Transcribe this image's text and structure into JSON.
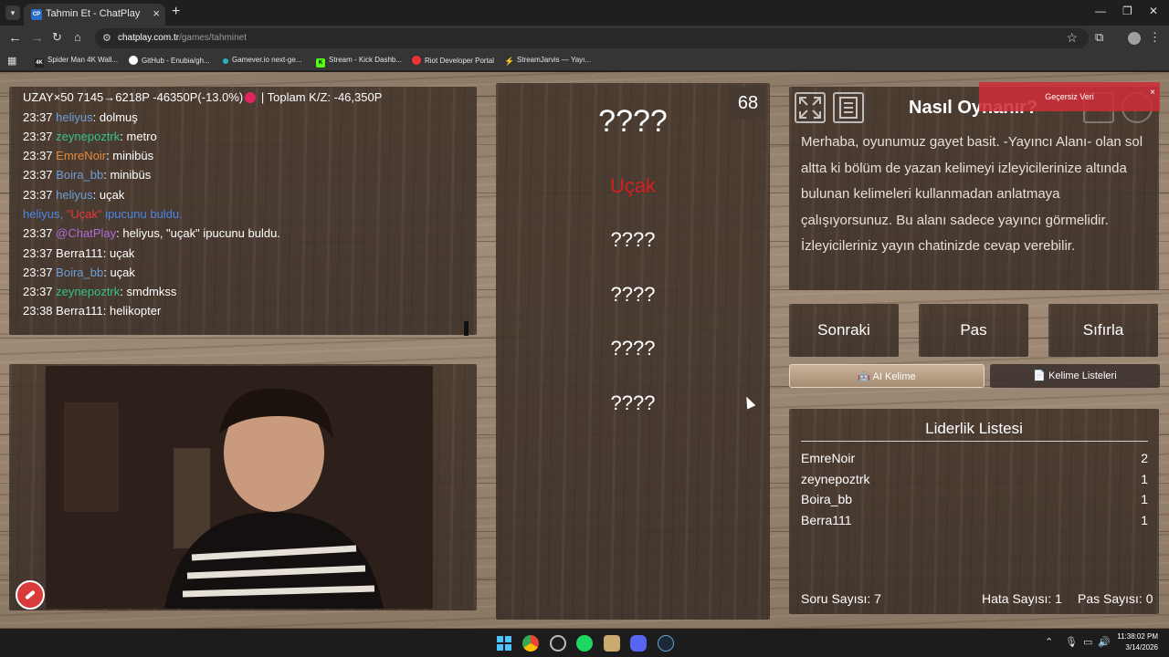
{
  "browser": {
    "tab_title": "Tahmin Et - ChatPlay",
    "tab_favicon": "CP",
    "url_host": "chatplay.com.tr",
    "url_path": "/games/tahminet",
    "bookmarks": [
      {
        "label": "Spider Man 4K Wall...",
        "icon": "4K"
      },
      {
        "label": "GitHub - Enubia/gh...",
        "icon": "github-icon"
      },
      {
        "label": "Gamever.io next-ge...",
        "icon": "gamever-icon"
      },
      {
        "label": "Stream - Kick Dashb...",
        "icon": "K"
      },
      {
        "label": "Riot Developer Portal",
        "icon": "riot-icon"
      },
      {
        "label": "StreamJarvis — Yayı...",
        "icon": "streamjarvis-icon"
      }
    ]
  },
  "chat": {
    "stats_line": "UZAY×50 7145→6218P -46350P(-13.0%)",
    "stats_total": "| Toplam K/Z: -46,350P",
    "messages": [
      {
        "time": "23:37",
        "user": "heliyus",
        "text": ": dolmuş"
      },
      {
        "time": "23:37",
        "user": "zeynepoztrk",
        "text": ": metro"
      },
      {
        "time": "23:37",
        "user": "EmreNoir",
        "text": ": minibüs"
      },
      {
        "time": "23:37",
        "user": "Boira_bb",
        "text": ": minibüs"
      },
      {
        "time": "23:37",
        "user": "heliyus",
        "text": ": uçak"
      },
      {
        "notice_user": "heliyus,",
        "notice_word": "\"Uçak\"",
        "notice_text": "ipucunu buldu."
      },
      {
        "time": "23:37",
        "user": "@ChatPlay",
        "text": ": heliyus, \"uçak\" ipucunu buldu."
      },
      {
        "time": "23:37",
        "user": "Berra111",
        "text": ": uçak"
      },
      {
        "time": "23:37",
        "user": "Boira_bb",
        "text": ": uçak"
      },
      {
        "time": "23:37",
        "user": "zeynepoztrk",
        "text": ": smdmkss"
      },
      {
        "time": "23:38",
        "user": "Berra111",
        "text": ": helikopter"
      }
    ]
  },
  "game": {
    "timer": "68",
    "main_word": "????",
    "clues": [
      "Uçak",
      "????",
      "????",
      "????",
      "????"
    ]
  },
  "howto": {
    "title": "Nasıl Oynanır?",
    "text": "Merhaba, oyunumuz gayet basit. -Yayıncı Alanı- olan sol altta ki bölüm de yazan kelimeyi izleyicilerinize altında bulunan kelimeleri kullanmadan anlatmaya çalışıyorsunuz. Bu alanı sadece yayıncı görmelidir. İzleyicileriniz yayın chatinizde cevap verebilir."
  },
  "toast": {
    "text": "Geçersiz Veri",
    "close": "×"
  },
  "controls": {
    "next": "Sonraki",
    "pass": "Pas",
    "reset": "Sıfırla",
    "ai_word": "AI Kelime",
    "word_lists": "Kelime Listeleri"
  },
  "leaderboard": {
    "title": "Liderlik Listesi",
    "rows": [
      {
        "name": "EmreNoir",
        "score": "2"
      },
      {
        "name": "zeynepoztrk",
        "score": "1"
      },
      {
        "name": "Boira_bb",
        "score": "1"
      },
      {
        "name": "Berra111",
        "score": "1"
      }
    ],
    "question_count": "Soru Sayısı: 7",
    "error_count": "Hata Sayısı: 1",
    "pass_count": "Pas Sayısı: 0"
  },
  "taskbar": {
    "time": "11:38:02 PM",
    "date": "3/14/2026"
  }
}
